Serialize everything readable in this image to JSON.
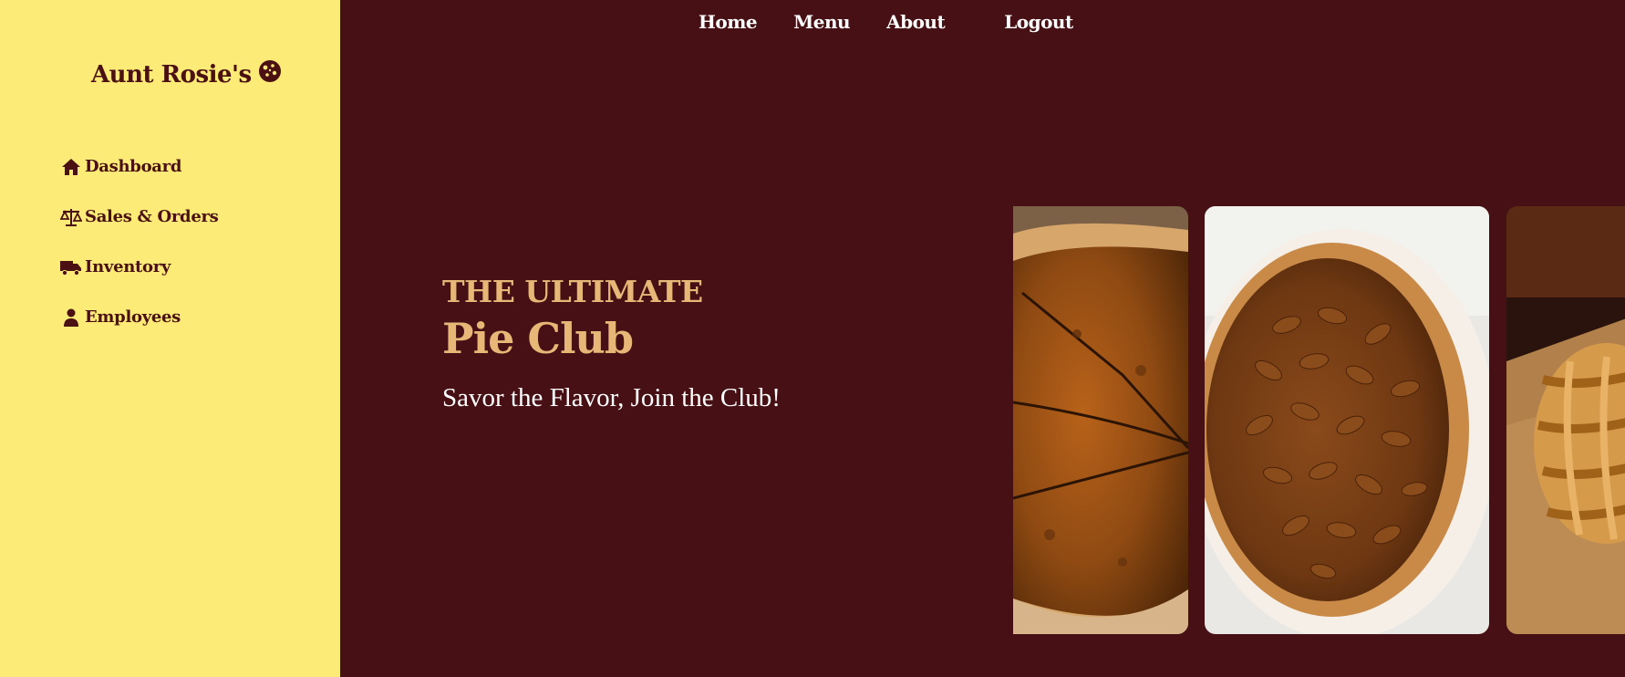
{
  "sidebar": {
    "brand_name": "Aunt Rosie's",
    "brand_icon": "cookie-icon",
    "items": [
      {
        "label": "Dashboard",
        "icon": "house-icon"
      },
      {
        "label": "Sales & Orders",
        "icon": "scale-icon"
      },
      {
        "label": "Inventory",
        "icon": "truck-icon"
      },
      {
        "label": "Employees",
        "icon": "user-icon"
      }
    ]
  },
  "topnav": {
    "home": "Home",
    "menu": "Menu",
    "about": "About",
    "logout": "Logout"
  },
  "hero": {
    "eyebrow": "THE ULTIMATE",
    "title": "Pie Club",
    "subtitle": "Savor the Flavor, Join the Club!"
  },
  "carousel": {
    "images": [
      {
        "name": "sliced-pumpkin-pie-image"
      },
      {
        "name": "pecan-pie-image"
      },
      {
        "name": "lattice-tart-image"
      }
    ]
  },
  "colors": {
    "sidebar_bg": "#fdeb78",
    "main_bg": "#461014",
    "brand_text": "#4a1012",
    "hero_accent": "#e7b777",
    "nav_text": "#ffffff"
  }
}
